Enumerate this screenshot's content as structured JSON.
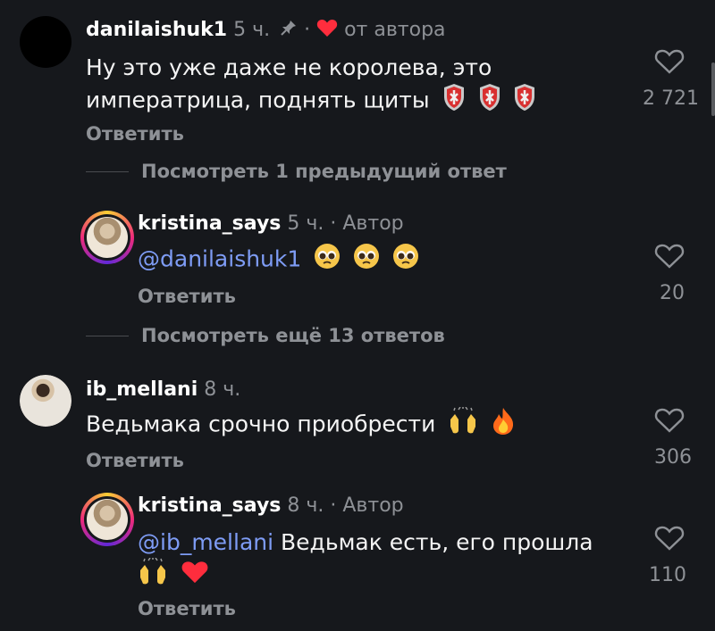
{
  "comments": [
    {
      "username": "danilaishuk1",
      "time": "5 ч.",
      "pinned_icon": "pin-icon",
      "author_like_label": "от автора",
      "text": "Ну это уже даже не королева, это императрица, поднять щиты",
      "emojis": [
        "shield-icon",
        "shield-icon",
        "shield-icon"
      ],
      "reply_label": "Ответить",
      "likes": "2 721"
    },
    {
      "thread_label": "Посмотреть 1 предыдущий ответ"
    },
    {
      "username": "kristina_says",
      "time": "5 ч.",
      "author_badge": "· Автор",
      "mention": "@danilaishuk1",
      "text": "",
      "emojis": [
        "pleading-face",
        "pleading-face",
        "pleading-face"
      ],
      "reply_label": "Ответить",
      "likes": "20"
    },
    {
      "thread_label": "Посмотреть ещё 13 ответов"
    },
    {
      "username": "ib_mellani",
      "time": "8 ч.",
      "text": "Ведьмака срочно приобрести",
      "emojis": [
        "raising-hands",
        "fire"
      ],
      "reply_label": "Ответить",
      "likes": "306"
    },
    {
      "username": "kristina_says",
      "time": "8 ч.",
      "author_badge": "· Автор",
      "mention": "@ib_mellani",
      "text": "Ведьмак есть, его прошла",
      "emojis": [
        "raising-hands",
        "red-heart"
      ],
      "reply_label": "Ответить",
      "likes": "110"
    }
  ],
  "colors": {
    "background": "#16181c",
    "mention": "#7e9cf5",
    "author_heart": "#ff2d3d",
    "muted": "#8e9196"
  }
}
